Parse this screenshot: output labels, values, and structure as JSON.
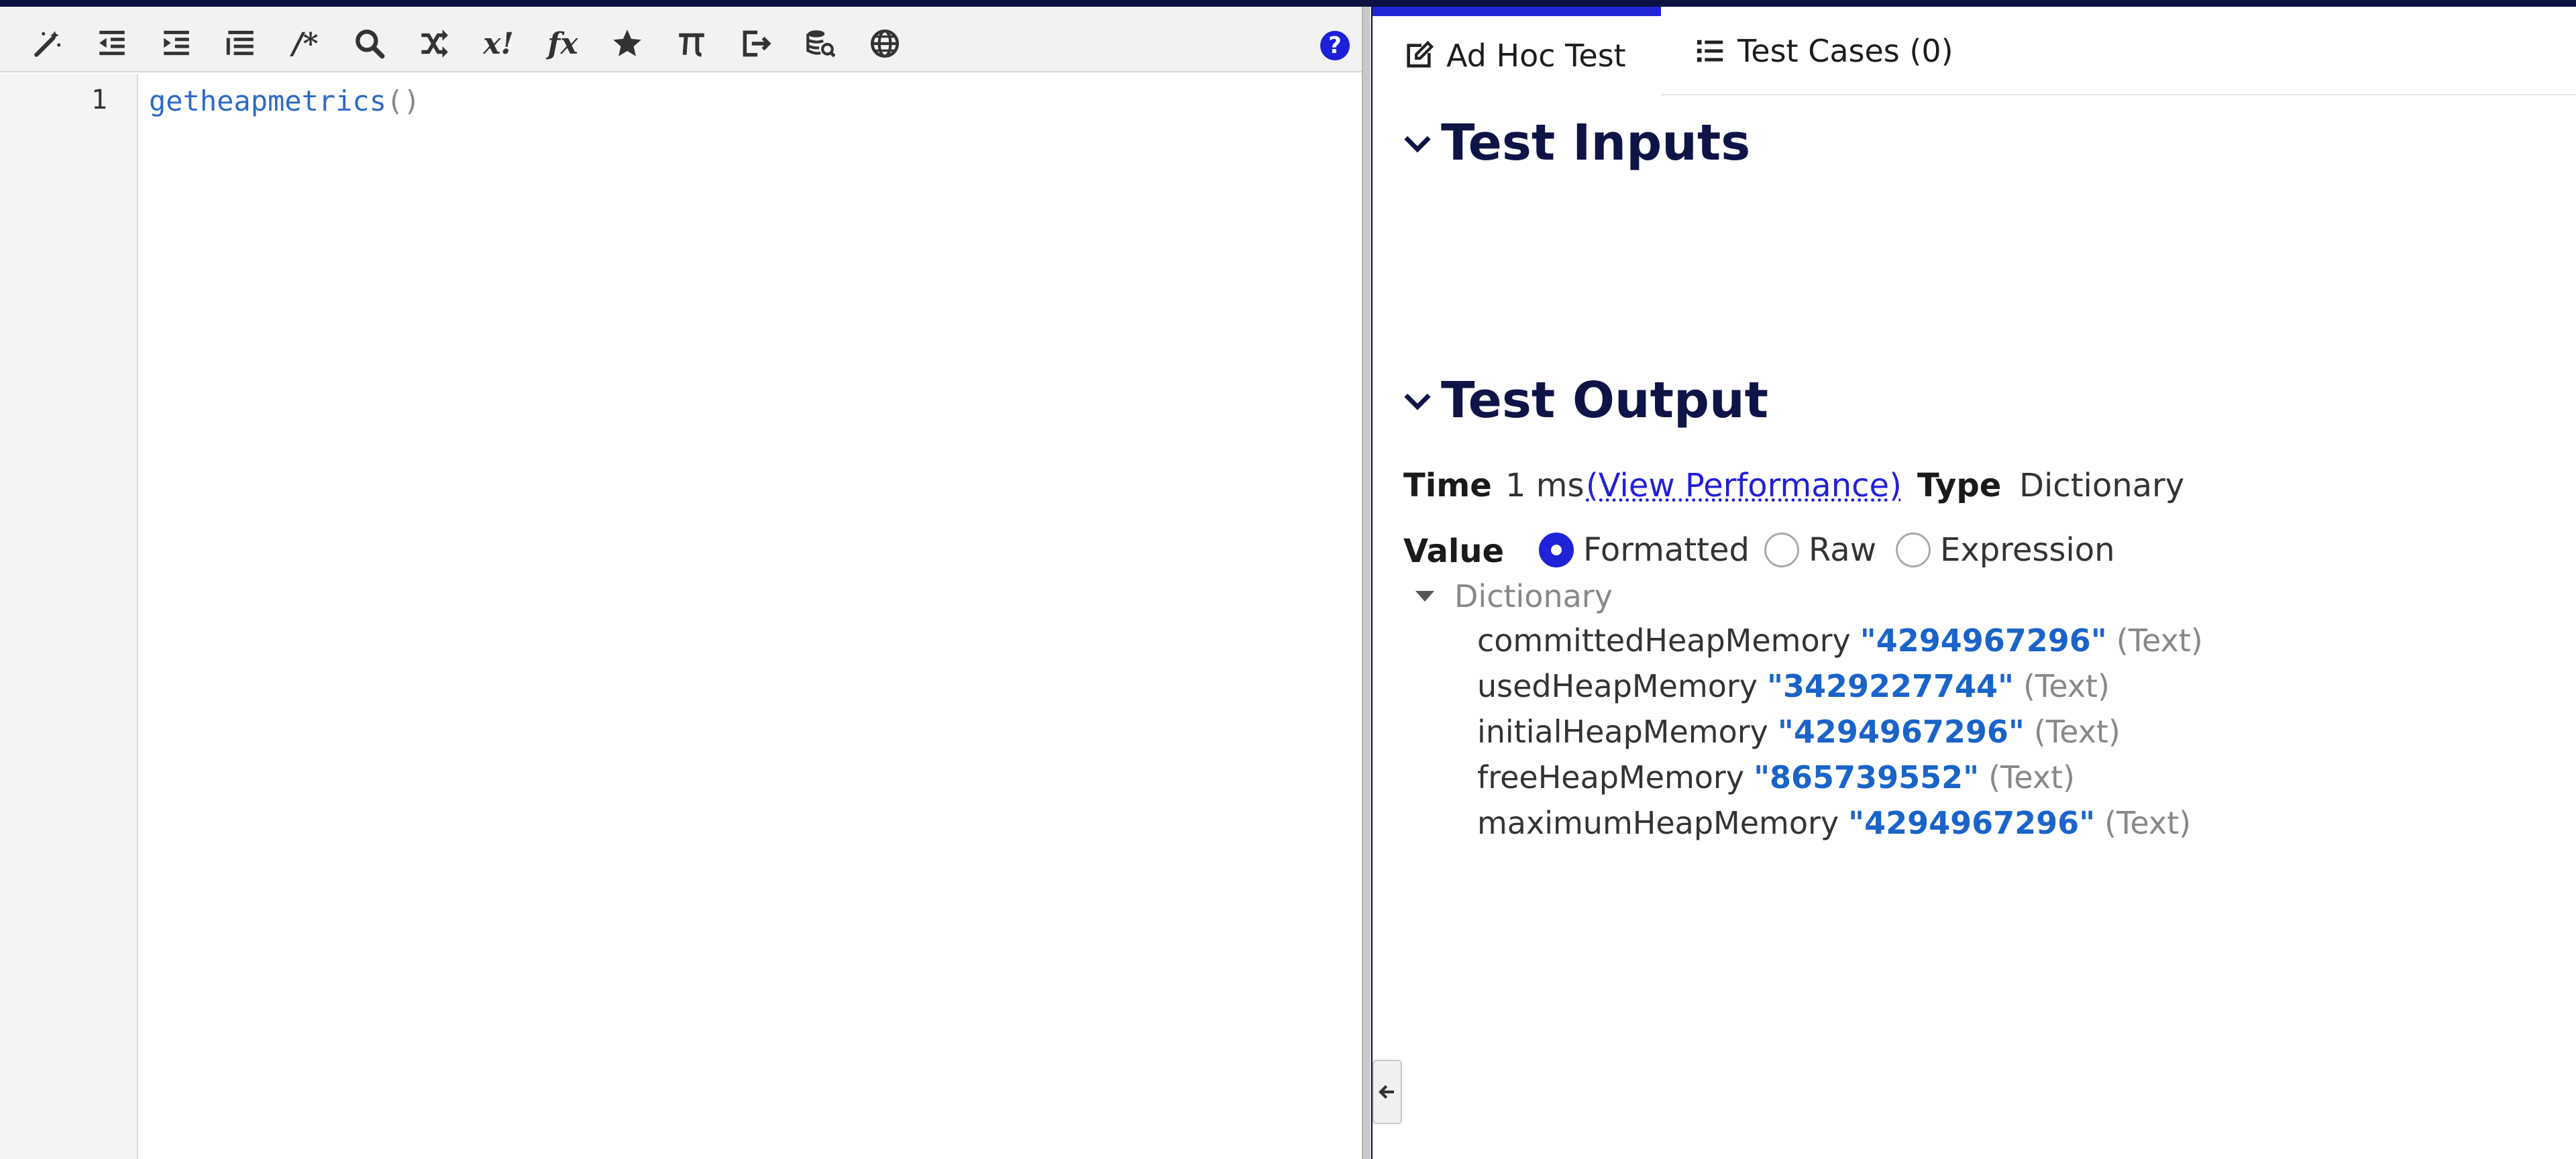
{
  "editor": {
    "toolbar": {
      "icons": [
        "magic-wand-icon",
        "outdent-icon",
        "indent-icon",
        "list-lines-icon",
        "comment-icon",
        "search-icon",
        "shuffle-icon",
        "x-bang-icon",
        "function-icon",
        "star-icon",
        "pi-icon",
        "export-icon",
        "database-search-icon",
        "globe-icon"
      ],
      "x_bang_label": "x!",
      "fx_label": "fx",
      "comment_label": "/*",
      "help_label": "?"
    },
    "line_number": "1",
    "code_function": "getheapmetrics",
    "code_parens": "()"
  },
  "panel": {
    "tabs": [
      {
        "label": "Ad Hoc Test",
        "active": true,
        "icon": "edit-icon"
      },
      {
        "label": "Test Cases (0)",
        "active": false,
        "icon": "list-icon"
      }
    ],
    "test_inputs_title": "Test Inputs",
    "test_output_title": "Test Output",
    "time_label": "Time",
    "time_value": "1 ms",
    "view_performance_link": "(View Performance)",
    "type_label": "Type",
    "type_value": "Dictionary",
    "value_label": "Value",
    "value_modes": [
      {
        "label": "Formatted",
        "checked": true
      },
      {
        "label": "Raw",
        "checked": false
      },
      {
        "label": "Expression",
        "checked": false
      }
    ],
    "dictionary_label": "Dictionary",
    "dictionary_rows": [
      {
        "key": "committedHeapMemory",
        "value": "\"4294967296\"",
        "type": "(Text)"
      },
      {
        "key": "usedHeapMemory",
        "value": "\"3429227744\"",
        "type": "(Text)"
      },
      {
        "key": "initialHeapMemory",
        "value": "\"4294967296\"",
        "type": "(Text)"
      },
      {
        "key": "freeHeapMemory",
        "value": "\"865739552\"",
        "type": "(Text)"
      },
      {
        "key": "maximumHeapMemory",
        "value": "\"4294967296\"",
        "type": "(Text)"
      }
    ]
  },
  "colors": {
    "accent": "#2225d5",
    "frame": "#0b1140",
    "code_blue": "#2c6bc9",
    "value_blue": "#1a63c9"
  }
}
